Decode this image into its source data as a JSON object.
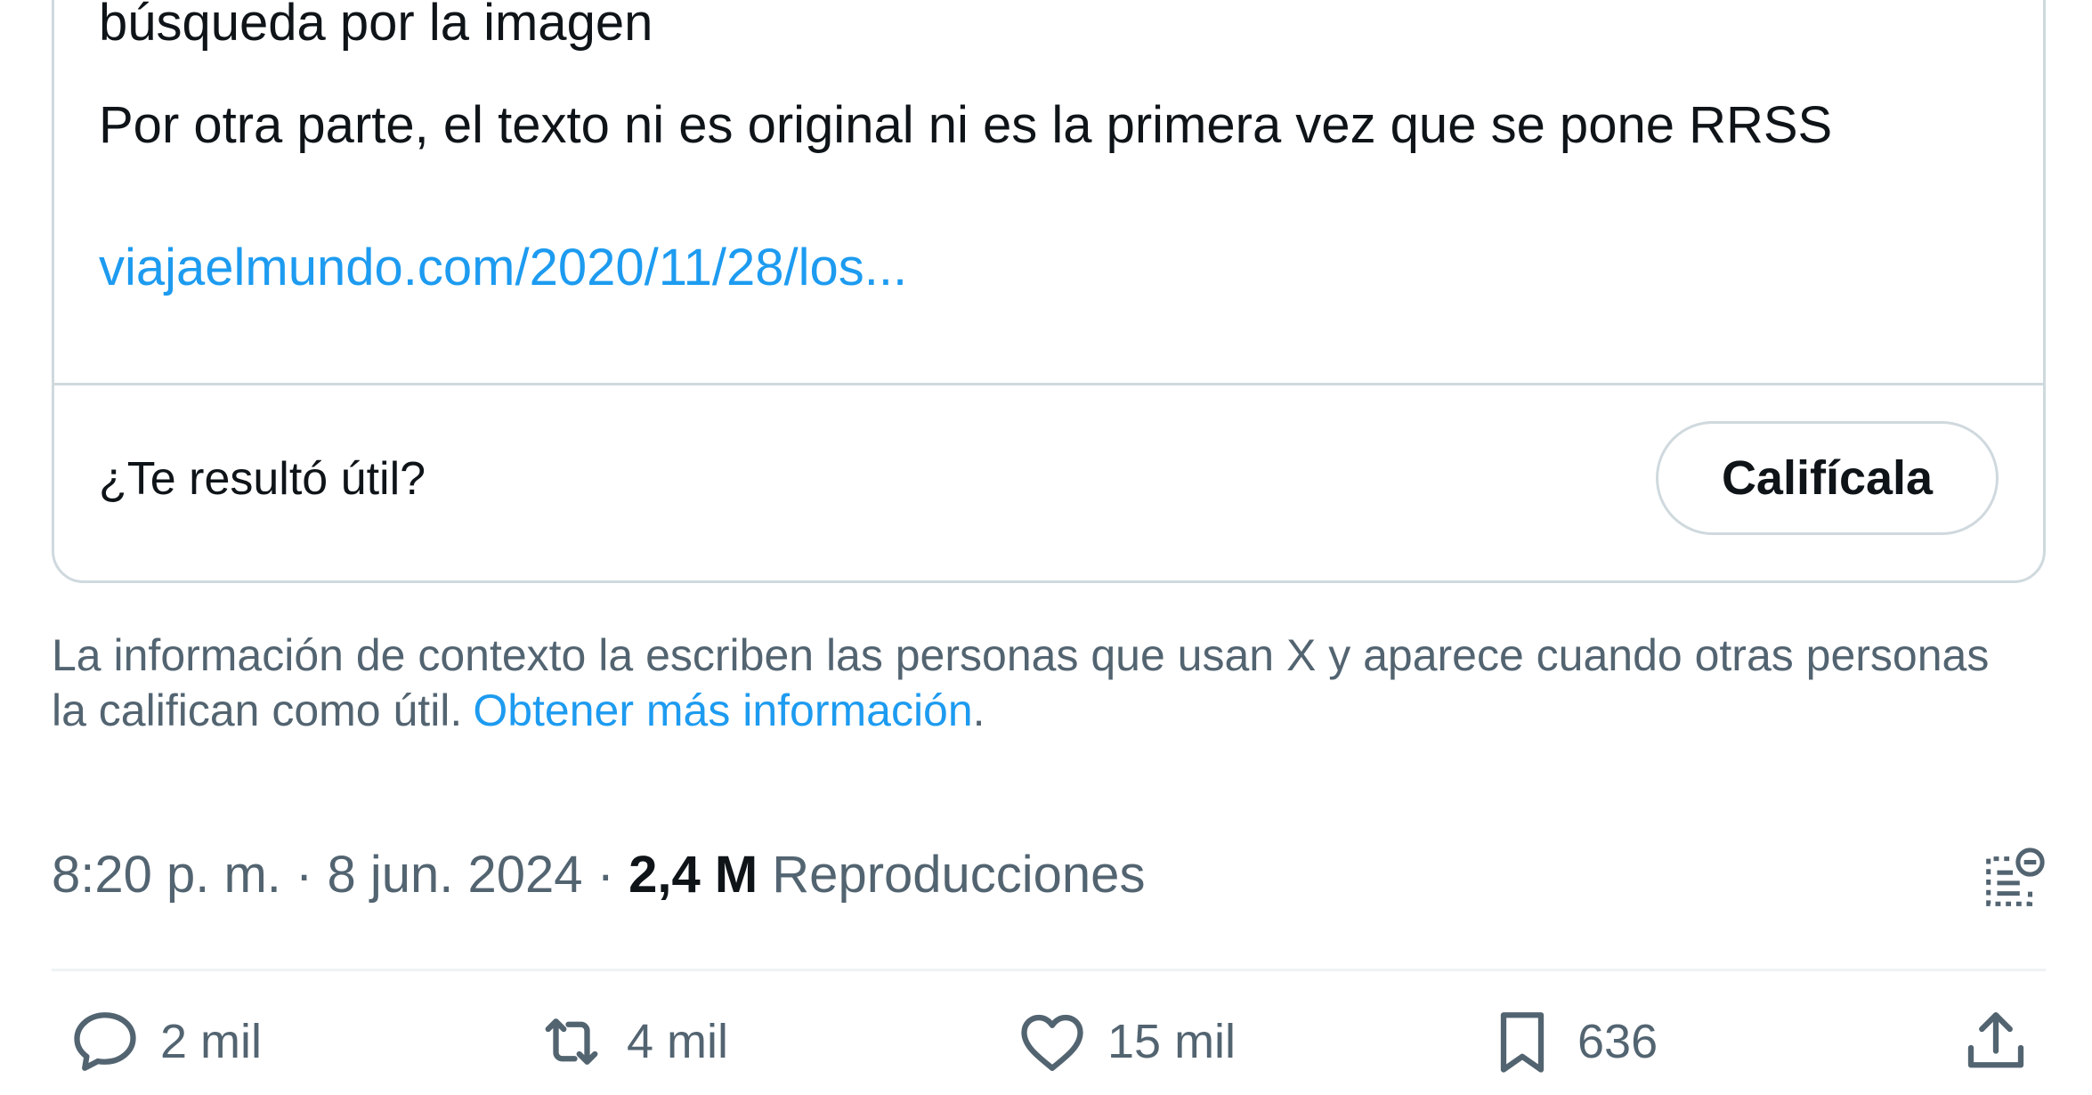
{
  "note": {
    "lines": [
      "búsqueda por la imagen",
      "Por otra parte, el texto ni es original ni es la primera vez que se pone RRSS"
    ],
    "link": "viajaelmundo.com/2020/11/28/los...",
    "rate_question": "¿Te resultó útil?",
    "rate_button": "Califícala"
  },
  "context": {
    "text": "La información de contexto la escriben las personas que usan X y aparece cuando otras personas la califican como útil.",
    "link": "Obtener más información",
    "period": "."
  },
  "meta": {
    "time": "8:20 p. m.",
    "date": "8 jun. 2024",
    "sep": "·",
    "views_count": "2,4 M",
    "views_label": "Reproducciones"
  },
  "actions": {
    "reply": {
      "icon": "reply-icon",
      "count": "2 mil"
    },
    "repost": {
      "icon": "repost-icon",
      "count": "4 mil"
    },
    "like": {
      "icon": "heart-icon",
      "count": "15 mil"
    },
    "bookmark": {
      "icon": "bookmark-icon",
      "count": "636"
    },
    "share": {
      "icon": "share-icon"
    }
  },
  "colors": {
    "link": "#1d9bf0",
    "secondary_text": "#536471",
    "primary_text": "#0f1419",
    "border": "#cfd9de"
  }
}
